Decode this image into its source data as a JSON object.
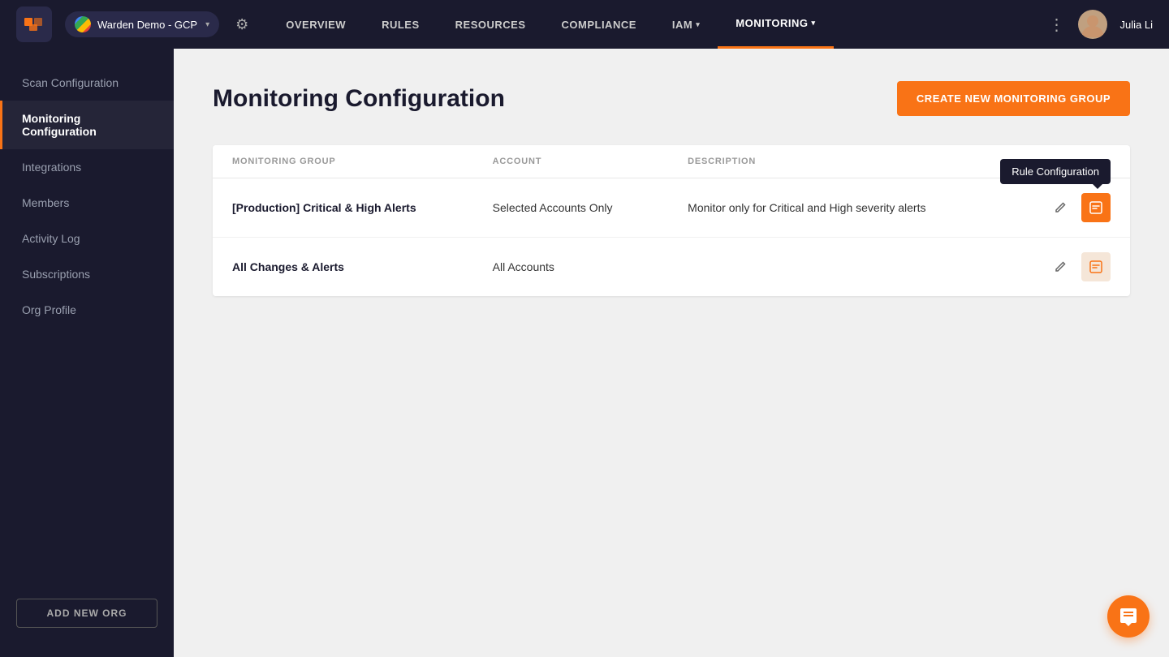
{
  "topnav": {
    "org_name": "Warden Demo - GCP",
    "nav_links": [
      {
        "label": "OVERVIEW",
        "active": false
      },
      {
        "label": "RULES",
        "active": false
      },
      {
        "label": "RESOURCES",
        "active": false
      },
      {
        "label": "COMPLIANCE",
        "active": false
      },
      {
        "label": "IAM",
        "active": false,
        "has_chevron": true
      },
      {
        "label": "MONITORING",
        "active": true,
        "has_chevron": true
      }
    ],
    "username": "Julia Li"
  },
  "sidebar": {
    "items": [
      {
        "label": "Scan Configuration",
        "active": false
      },
      {
        "label": "Monitoring Configuration",
        "active": true
      },
      {
        "label": "Integrations",
        "active": false
      },
      {
        "label": "Members",
        "active": false
      },
      {
        "label": "Activity Log",
        "active": false
      },
      {
        "label": "Subscriptions",
        "active": false
      },
      {
        "label": "Org Profile",
        "active": false
      }
    ],
    "add_button_label": "ADD NEW ORG"
  },
  "page": {
    "title": "Monitoring Configuration",
    "create_button_label": "CREATE NEW MONITORING GROUP"
  },
  "table": {
    "headers": [
      {
        "label": "MONITORING GROUP"
      },
      {
        "label": "ACCOUNT"
      },
      {
        "label": "DESCRIPTION"
      },
      {
        "label": ""
      }
    ],
    "rows": [
      {
        "monitoring_group": "[Production] Critical & High Alerts",
        "account": "Selected Accounts Only",
        "description": "Monitor only for Critical and High severity alerts",
        "show_tooltip": true
      },
      {
        "monitoring_group": "All Changes & Alerts",
        "account": "All Accounts",
        "description": "",
        "show_tooltip": false
      }
    ],
    "tooltip_label": "Rule Configuration"
  },
  "chat_button_title": "Chat support"
}
